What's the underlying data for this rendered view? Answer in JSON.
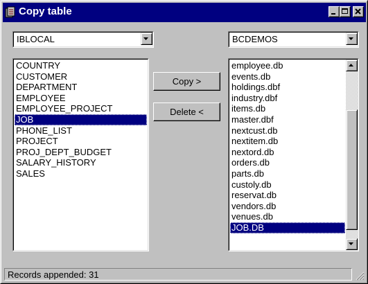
{
  "window": {
    "title": "Copy table"
  },
  "source": {
    "database": "IBLOCAL",
    "tables": [
      "COUNTRY",
      "CUSTOMER",
      "DEPARTMENT",
      "EMPLOYEE",
      "EMPLOYEE_PROJECT",
      "JOB",
      "PHONE_LIST",
      "PROJECT",
      "PROJ_DEPT_BUDGET",
      "SALARY_HISTORY",
      "SALES"
    ],
    "selected_index": 5
  },
  "target": {
    "database": "BCDEMOS",
    "tables": [
      "employee.db",
      "events.db",
      "holdings.dbf",
      "industry.dbf",
      "items.db",
      "master.dbf",
      "nextcust.db",
      "nextitem.db",
      "nextord.db",
      "orders.db",
      "parts.db",
      "custoly.db",
      "reservat.db",
      "vendors.db",
      "venues.db",
      "JOB.DB"
    ],
    "selected_index": 15
  },
  "actions": {
    "copy_label": "Copy >",
    "delete_label": "Delete <"
  },
  "status": {
    "text": "Records appended: 31"
  },
  "colors": {
    "selection": "#000080",
    "face": "#c0c0c0",
    "title_bar": "#000080"
  }
}
